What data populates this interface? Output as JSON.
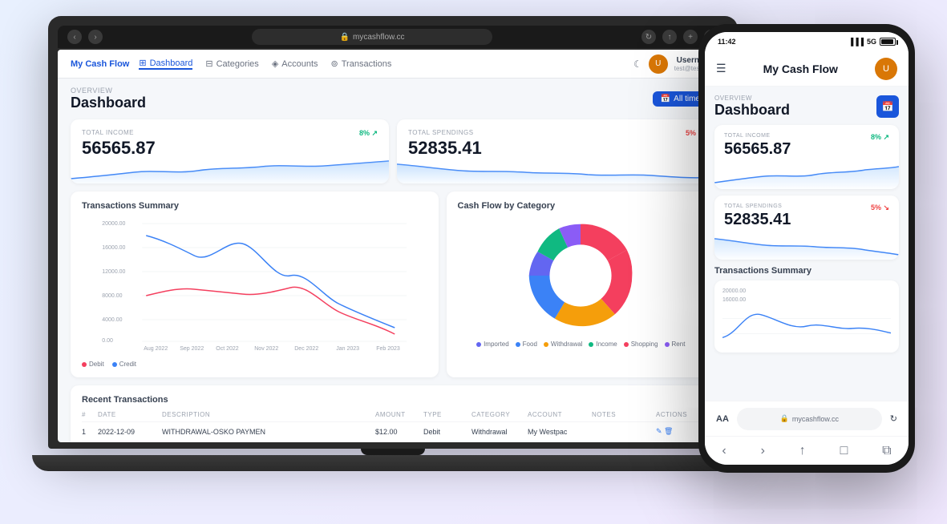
{
  "laptop": {
    "url": "mycashflow.cc",
    "title": "My Cash Flow",
    "nav": {
      "items": [
        {
          "label": "Dashboard",
          "active": true
        },
        {
          "label": "Categories"
        },
        {
          "label": "Accounts"
        },
        {
          "label": "Transactions"
        }
      ]
    },
    "user": {
      "name": "Username",
      "email": "test@test.com"
    },
    "dashboard": {
      "overview_label": "OVERVIEW",
      "title": "Dashboard",
      "filter_btn": "All time",
      "income_card": {
        "label": "TOTAL INCOME",
        "value": "56565.87",
        "badge": "8%",
        "trend": "up"
      },
      "spending_card": {
        "label": "TOTAL SPENDINGS",
        "value": "52835.41",
        "badge": "5%",
        "trend": "down"
      },
      "transactions_summary": {
        "title": "Transactions Summary",
        "y_labels": [
          "20000.00",
          "16000.00",
          "12000.00",
          "8000.00",
          "4000.00",
          "0.00"
        ],
        "x_labels": [
          "Aug 2022",
          "Sep 2022",
          "Oct 2022",
          "Nov 2022",
          "Dec 2022",
          "Jan 2023",
          "Feb 2023"
        ],
        "legend": [
          {
            "label": "Debit",
            "color": "#f43f5e"
          },
          {
            "label": "Credit",
            "color": "#3b82f6"
          }
        ]
      },
      "cashflow_category": {
        "title": "Cash Flow by Category",
        "legend": [
          {
            "label": "Imported",
            "color": "#6366f1"
          },
          {
            "label": "Food",
            "color": "#3b82f6"
          },
          {
            "label": "Withdrawal",
            "color": "#f59e0b"
          },
          {
            "label": "Income",
            "color": "#10b981"
          },
          {
            "label": "Shopping",
            "color": "#f43f5e"
          },
          {
            "label": "Rent",
            "color": "#8b5cf6"
          }
        ]
      },
      "recent_transactions": {
        "title": "Recent Transactions",
        "columns": [
          "#",
          "DATE",
          "DESCRIPTION",
          "AMOUNT",
          "TYPE",
          "CATEGORY",
          "ACCOUNT",
          "NOTES",
          "ACTIONS"
        ],
        "rows": [
          {
            "id": "1",
            "date": "2022-12-09",
            "description": "WITHDRAWAL-OSKO PAYMEN",
            "amount": "$12.00",
            "type": "Debit",
            "category": "Withdrawal",
            "account": "My Westpac",
            "notes": "",
            "actions": "edit"
          }
        ]
      }
    }
  },
  "phone": {
    "time": "11:42",
    "signal": "5G",
    "title": "My Cash Flow",
    "url": "mycashflow.cc",
    "dashboard": {
      "overview_label": "OVERVIEW",
      "title": "Dashboard",
      "income_card": {
        "label": "TOTAL INCOME",
        "value": "56565.87",
        "badge": "8%",
        "trend": "up"
      },
      "spending_card": {
        "label": "TOTAL SPENDINGS",
        "value": "52835.41",
        "badge": "5%",
        "trend": "down"
      },
      "transactions_summary": {
        "title": "Transactions Summary",
        "y_labels": [
          "20000.00",
          "16000.00"
        ]
      }
    },
    "bottom_nav": {
      "back": "‹",
      "forward": "›",
      "share": "↑",
      "bookmarks": "□",
      "tabs": "⧉"
    }
  },
  "icons": {
    "aa": "AA",
    "lock": "🔒",
    "reload": "↻",
    "back": "‹",
    "forward": "›",
    "book": "□",
    "add_tab": "+",
    "tabs": "⧉"
  }
}
